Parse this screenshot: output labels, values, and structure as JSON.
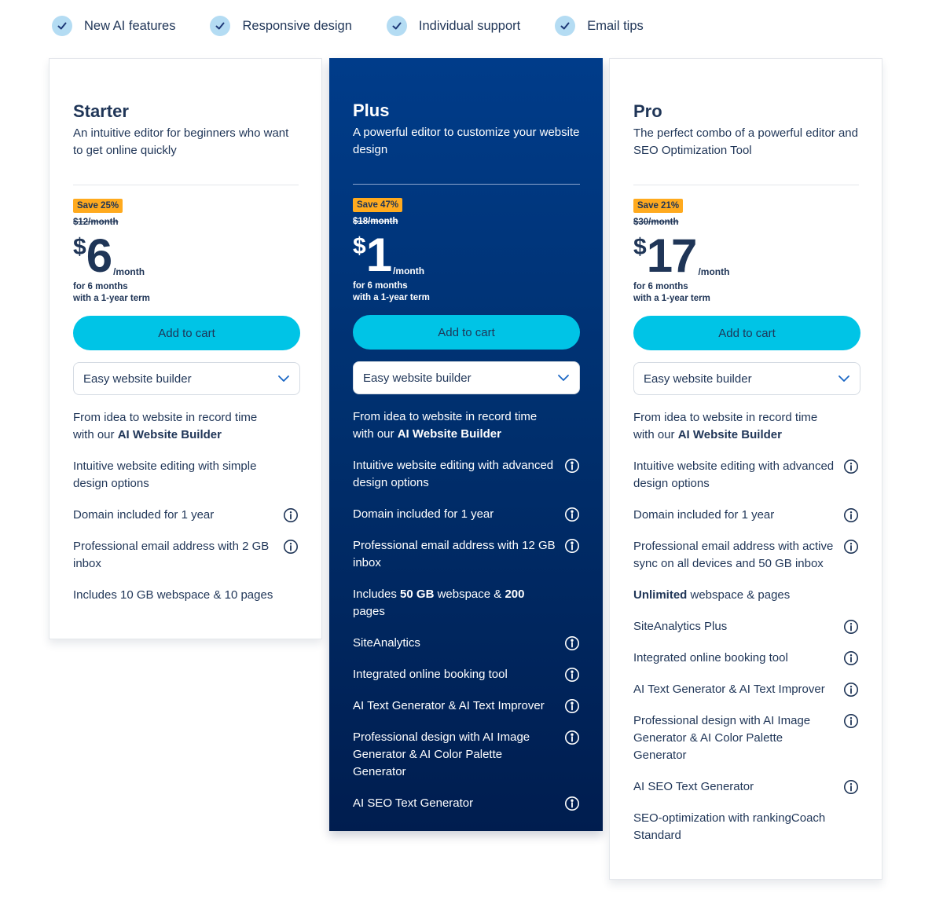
{
  "features_bar": [
    {
      "icon": "check-icon",
      "label": "New AI features"
    },
    {
      "icon": "check-icon",
      "label": "Responsive design"
    },
    {
      "icon": "check-icon",
      "label": "Individual support"
    },
    {
      "icon": "check-icon",
      "label": "Email tips"
    }
  ],
  "colors": {
    "accent_button": "#00c4e6",
    "save_badge": "#ffaa1e",
    "text_dark": "#1f3557",
    "plus_card_top": "#003c8a",
    "plus_card_bottom": "#001d4f",
    "check_circle": "#b4dcf3"
  },
  "plans": [
    {
      "name": "Starter",
      "description": "An intuitive editor for beginners who want to get online quickly",
      "save_badge": "Save 25%",
      "old_price": "$12/month",
      "currency": "$",
      "price": "6",
      "per": "/month",
      "term_line1": "for 6 months",
      "term_line2": "with a 1-year term",
      "cta": "Add to cart",
      "select_value": "Easy website builder",
      "features": [
        {
          "pre": "From idea to website in record time with our ",
          "bold": "AI Website Builder",
          "post": "",
          "info": false
        },
        {
          "pre": "Intuitive website editing with simple design options",
          "info": false
        },
        {
          "pre": "Domain included for 1 year",
          "info": true
        },
        {
          "pre": "Professional email address with 2 GB inbox",
          "info": true
        },
        {
          "pre": "Includes 10 GB webspace & 10 pages",
          "info": false
        }
      ]
    },
    {
      "name": "Plus",
      "description": "A powerful editor to customize your website design",
      "save_badge": "Save 47%",
      "old_price": "$18/month",
      "currency": "$",
      "price": "1",
      "per": "/month",
      "term_line1": "for 6 months",
      "term_line2": "with a 1-year term",
      "cta": "Add to cart",
      "select_value": "Easy website builder",
      "features": [
        {
          "pre": "From idea to website in record time with our ",
          "bold": "AI Website Builder",
          "post": "",
          "info": false
        },
        {
          "pre": "Intuitive website editing with advanced design options",
          "info": true
        },
        {
          "pre": "Domain included for 1 year",
          "info": true
        },
        {
          "pre": "Professional email address with 12 GB inbox",
          "info": true
        },
        {
          "pre": "Includes ",
          "bold": "50 GB",
          "mid": " webspace & ",
          "bold2": "200",
          "post": " pages",
          "info": false
        },
        {
          "pre": "SiteAnalytics",
          "info": true
        },
        {
          "pre": "Integrated online booking tool",
          "info": true
        },
        {
          "pre": "AI Text Generator & AI Text Improver",
          "info": true
        },
        {
          "pre": "Professional design with AI Image Generator & AI Color Palette Generator",
          "info": true
        },
        {
          "pre": "AI SEO Text Generator",
          "info": true
        }
      ]
    },
    {
      "name": "Pro",
      "description": "The perfect combo of a powerful editor and SEO Optimization Tool",
      "save_badge": "Save 21%",
      "old_price": "$30/month",
      "currency": "$",
      "price": "17",
      "per": "/month",
      "term_line1": "for 6 months",
      "term_line2": "with a 1-year term",
      "cta": "Add to cart",
      "select_value": "Easy website builder",
      "features": [
        {
          "pre": "From idea to website in record time with our ",
          "bold": "AI Website Builder",
          "post": "",
          "info": false
        },
        {
          "pre": "Intuitive website editing with advanced design options",
          "info": true
        },
        {
          "pre": "Domain included for 1 year",
          "info": true
        },
        {
          "pre": "Professional email address with active sync on all devices and 50 GB inbox",
          "info": true
        },
        {
          "bold": "Unlimited",
          "post": " webspace & pages",
          "info": false
        },
        {
          "pre": "SiteAnalytics Plus",
          "info": true
        },
        {
          "pre": "Integrated online booking tool",
          "info": true
        },
        {
          "pre": "AI Text Generator & AI Text Improver",
          "info": true
        },
        {
          "pre": "Professional design with AI Image Generator & AI Color Palette Generator",
          "info": true
        },
        {
          "pre": "AI SEO Text Generator",
          "info": true
        },
        {
          "pre": "SEO-optimization with rankingCoach Standard",
          "info": false
        }
      ]
    }
  ]
}
